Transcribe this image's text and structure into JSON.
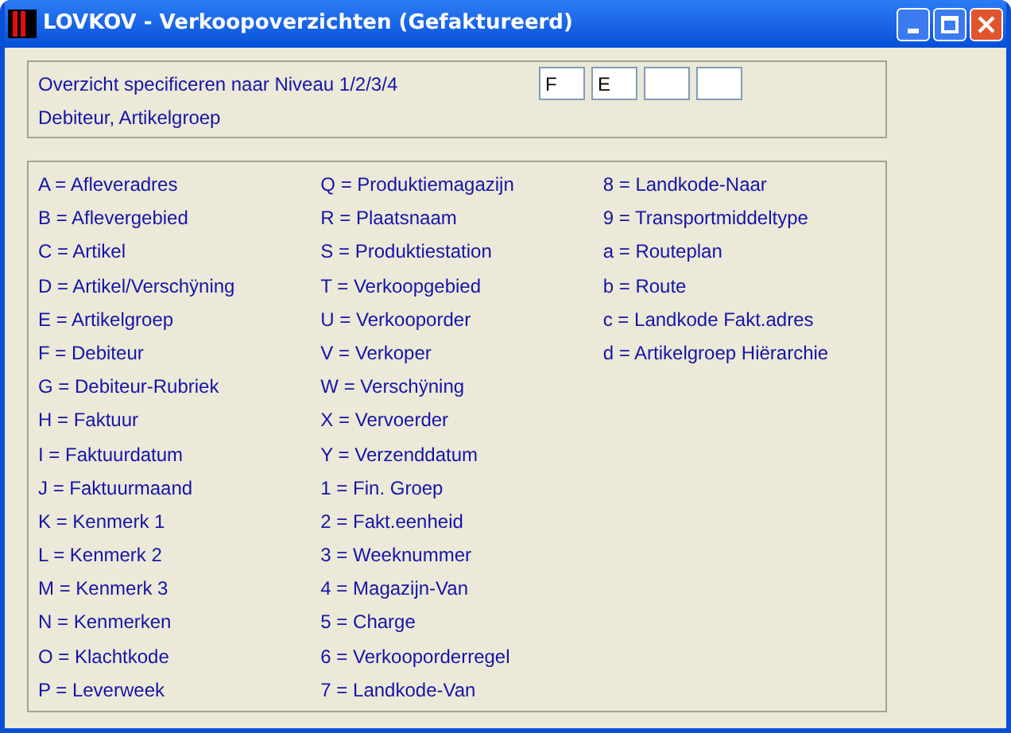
{
  "window": {
    "title": "LOVKOV - Verkoopoverzichten (Gefaktureerd)"
  },
  "level_panel": {
    "label": "Overzicht specificeren naar Niveau 1/2/3/4",
    "description": "Debiteur, Artikelgroep",
    "fields": [
      {
        "kind": "text",
        "value": "F"
      },
      {
        "kind": "text",
        "value": "E"
      },
      {
        "kind": "empty"
      },
      {
        "kind": "empty"
      }
    ]
  },
  "codes": [
    [
      "A = Afleveradres",
      "B = Aflevergebied",
      "C = Artikel",
      "D = Artikel/Verschÿning",
      "E = Artikelgroep",
      "F = Debiteur",
      "G = Debiteur-Rubriek",
      "H = Faktuur",
      "I = Faktuurdatum",
      "J = Faktuurmaand",
      "K = Kenmerk 1",
      "L = Kenmerk 2",
      "M = Kenmerk 3",
      "N = Kenmerken",
      "O = Klachtkode",
      "P = Leverweek"
    ],
    [
      "Q = Produktiemagazijn",
      "R = Plaatsnaam",
      "S = Produktiestation",
      "T = Verkoopgebied",
      "U = Verkooporder",
      "V = Verkoper",
      "W = Verschÿning",
      "X = Vervoerder",
      "Y = Verzenddatum",
      "1 = Fin. Groep",
      "2 = Fakt.eenheid",
      "3 = Weeknummer",
      "4 = Magazijn-Van",
      "5 = Charge",
      "6 = Verkooporderregel",
      "7 = Landkode-Van"
    ],
    [
      "8 = Landkode-Naar",
      "9 = Transportmiddeltype",
      "a = Routeplan",
      "b = Route",
      "c = Landkode Fakt.adres",
      "d = Artikelgroep Hiërarchie"
    ]
  ]
}
